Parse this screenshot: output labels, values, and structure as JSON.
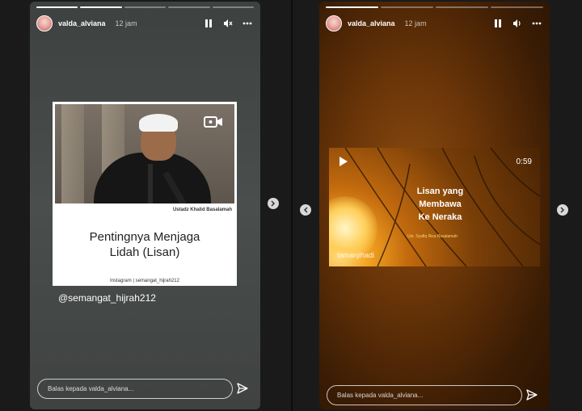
{
  "story1": {
    "username": "valda_alviana",
    "time": "12 jam",
    "progress": [
      1,
      1,
      0,
      0,
      0
    ],
    "card": {
      "speaker": "Ustadz Khalid Basalamah",
      "title_line1": "Pentingnya Menjaga",
      "title_line2": "Lidah (Lisan)",
      "instagram": "Instagram | semangat_hijrah212"
    },
    "mention": "@semangat_hijrah212",
    "reply_placeholder": "Balas kepada valda_alviana..."
  },
  "story2": {
    "username": "valda_alviana",
    "time": "12 jam",
    "progress": [
      1,
      0,
      0,
      0
    ],
    "video": {
      "duration": "0:59",
      "title_line1": "Lisan yang",
      "title_line2": "Membawa",
      "title_line3": "Ke Neraka",
      "subtitle": "Ust. Syafiq Riza Basalamah",
      "brand": "tamanjihadi"
    },
    "reply_placeholder": "Balas kepada valda_alviana..."
  },
  "colors": {
    "accent": "#ffffff",
    "video_subtitle": "#ffd86a"
  }
}
